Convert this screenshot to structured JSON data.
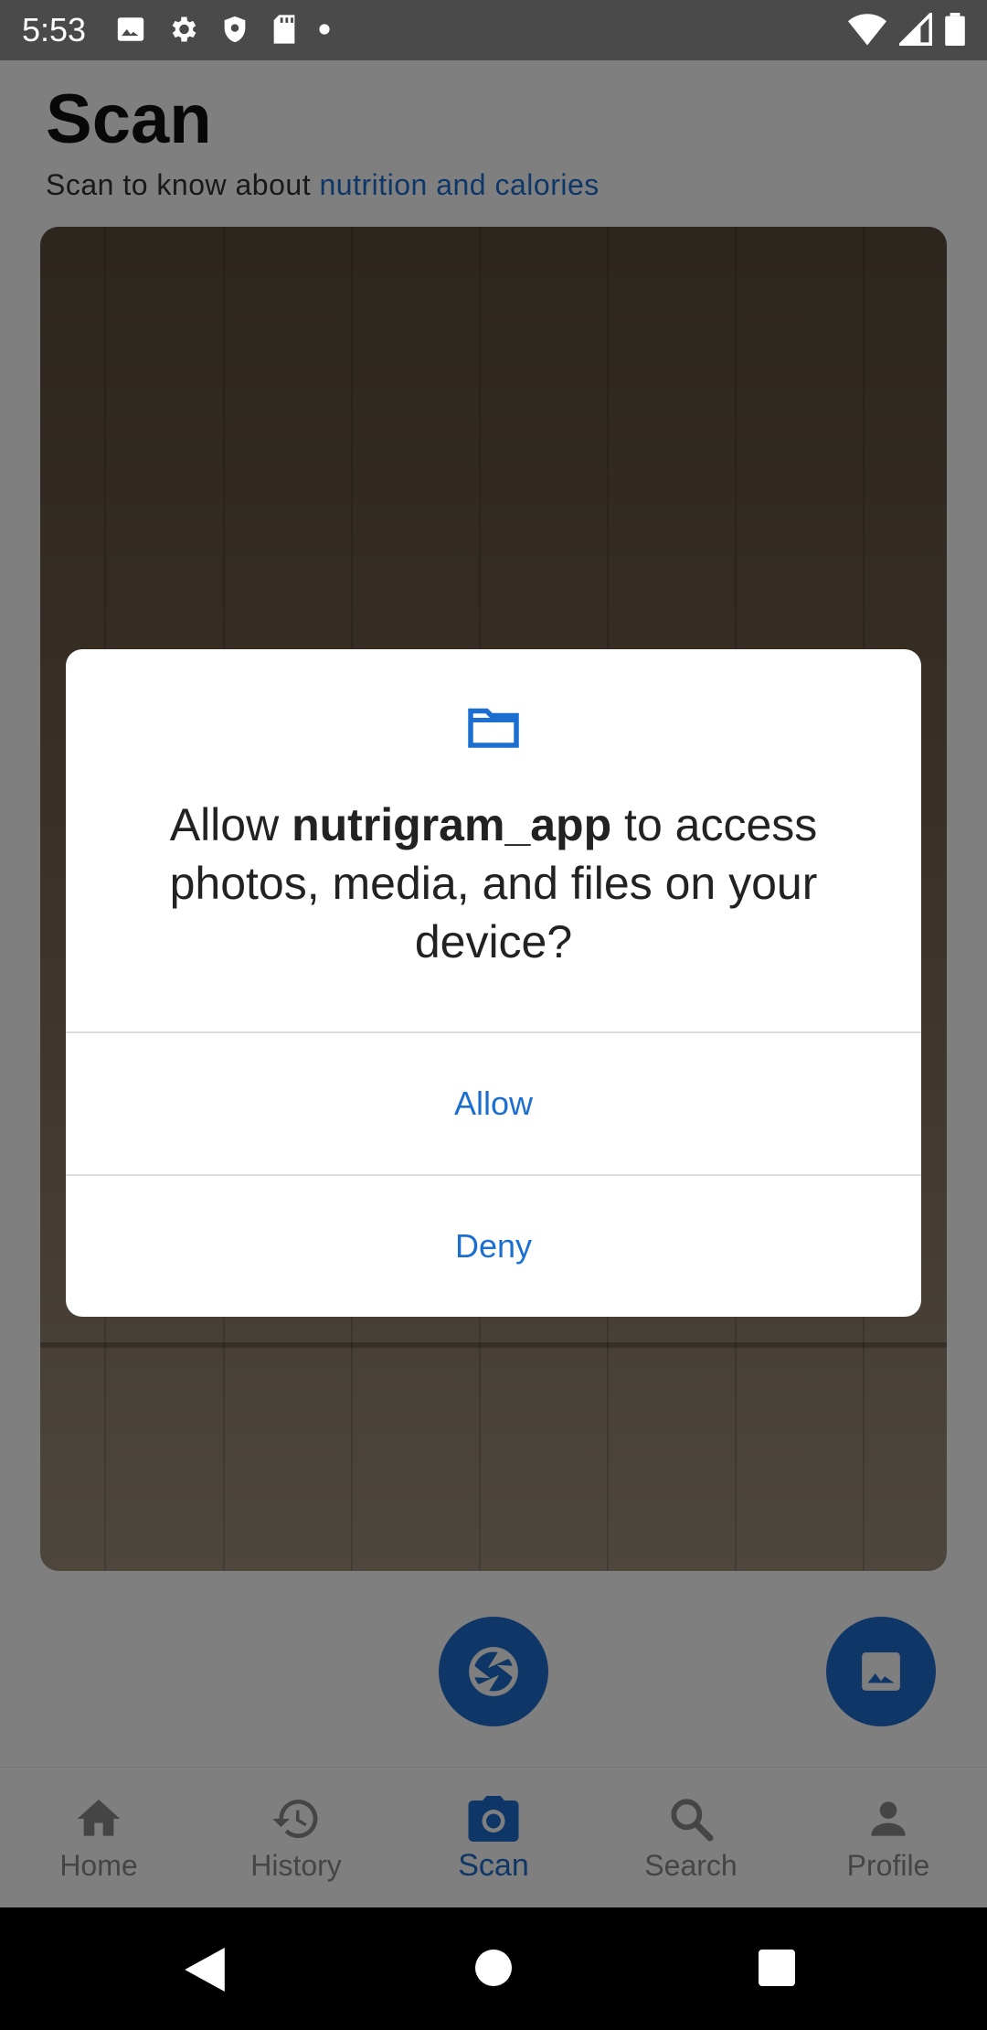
{
  "status_bar": {
    "time": "5:53",
    "left_icons": [
      "image-icon",
      "gear-icon",
      "shield-icon",
      "sd-card-icon",
      "dot-icon"
    ],
    "right_icons": [
      "wifi-icon",
      "signal-icon",
      "battery-icon"
    ]
  },
  "header": {
    "title": "Scan",
    "subtitle_prefix": "Scan to know about ",
    "subtitle_accent": "nutrition and calories"
  },
  "actions": {
    "shutter_icon": "camera-shutter-icon",
    "gallery_icon": "image-icon"
  },
  "bottom_nav": {
    "items": [
      {
        "label": "Home",
        "icon": "home-icon",
        "active": false
      },
      {
        "label": "History",
        "icon": "history-icon",
        "active": false
      },
      {
        "label": "Scan",
        "icon": "camera-icon",
        "active": true
      },
      {
        "label": "Search",
        "icon": "search-icon",
        "active": false
      },
      {
        "label": "Profile",
        "icon": "person-icon",
        "active": false
      }
    ]
  },
  "dialog": {
    "icon": "folder-icon",
    "message_prefix": "Allow ",
    "app_name": "nutrigram_app",
    "message_suffix": " to access photos, media, and files on your device?",
    "allow_label": "Allow",
    "deny_label": "Deny"
  },
  "colors": {
    "accent": "#1c6fd1",
    "status_bar": "#4a4a4a",
    "scrim": "rgba(0,0,0,0.5)"
  }
}
